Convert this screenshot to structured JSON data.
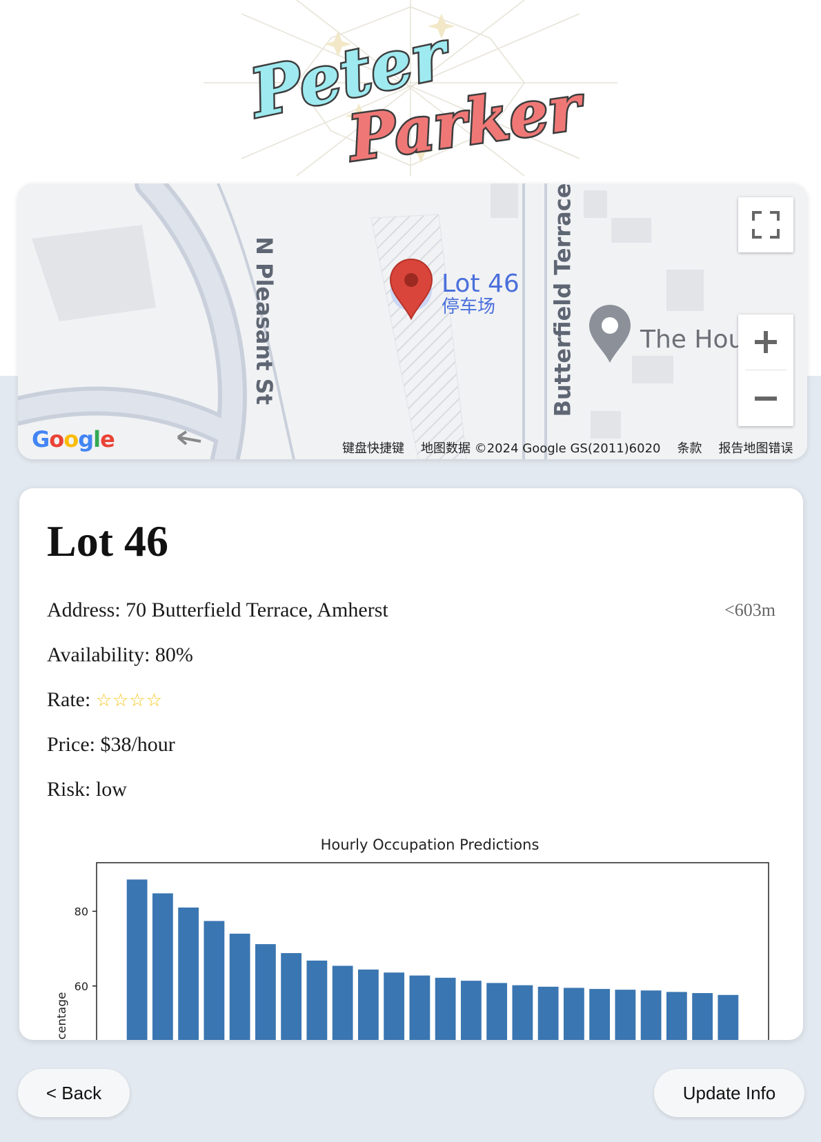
{
  "logo": {
    "line1": "Peter",
    "line2": "Parker"
  },
  "map": {
    "marker_label": "Lot 46",
    "marker_sublabel": "停车场",
    "poi_label": "The Hou",
    "streets": [
      "N Pleasant St",
      "Butterfield Terrace"
    ],
    "google_logo": "Google",
    "footer": [
      "键盘快捷键",
      "地图数据 ©2024 Google GS(2011)6020",
      "条款",
      "报告地图错误"
    ]
  },
  "lot": {
    "name": "Lot 46",
    "address": "Address: 70 Butterfield Terrace, Amherst",
    "distance": "<603m",
    "availability": "Availability: 80%",
    "rate_label": "Rate: ",
    "rate_stars": "☆☆☆☆",
    "rate_value": 4,
    "price": "Price: $38/hour",
    "risk": "Risk: low"
  },
  "chart_data": {
    "type": "bar",
    "title": "Hourly Occupation Predictions",
    "ylabel": "centage",
    "yticks": [
      60,
      80
    ],
    "ylim": [
      45,
      93
    ],
    "values": [
      88.5,
      84.8,
      81.0,
      77.4,
      74.0,
      71.2,
      68.8,
      66.8,
      65.4,
      64.4,
      63.6,
      62.8,
      62.2,
      61.4,
      60.8,
      60.2,
      59.8,
      59.5,
      59.2,
      59.0,
      58.8,
      58.4,
      58.1,
      57.6
    ],
    "color": "#3a76b1"
  },
  "buttons": {
    "back": "< Back",
    "update": "Update Info"
  }
}
